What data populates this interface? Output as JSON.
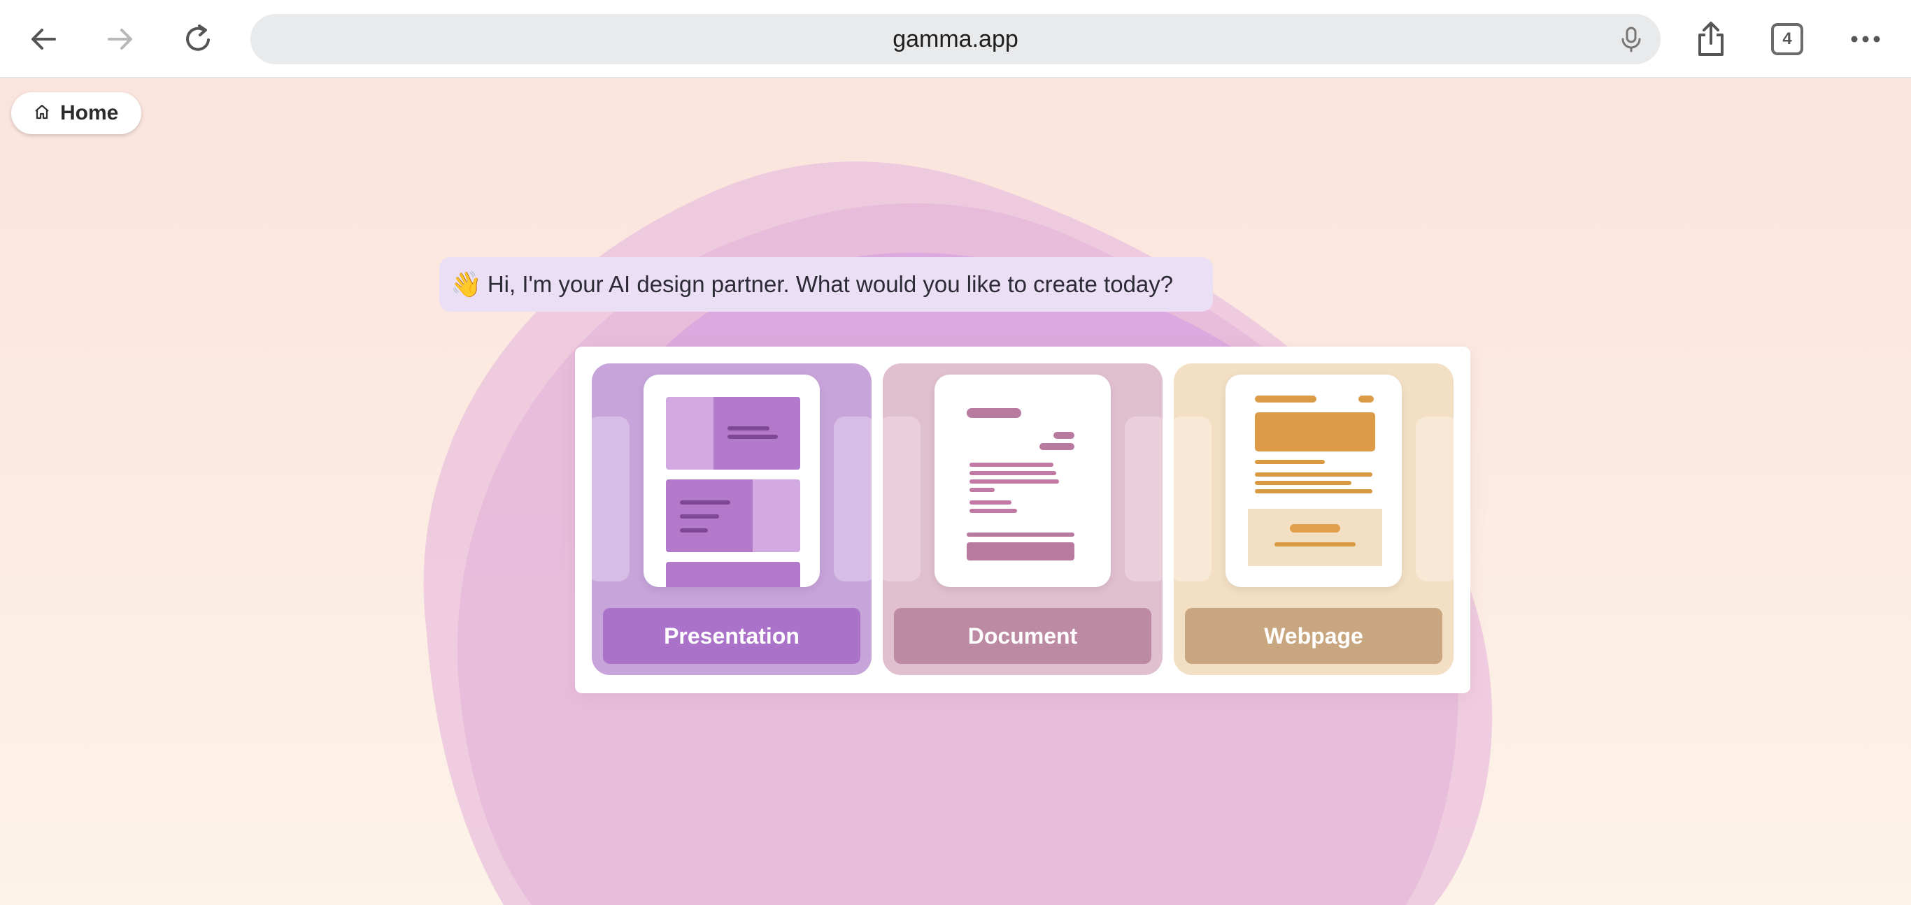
{
  "browser": {
    "url": "gamma.app",
    "tab_count": "4",
    "icons": [
      "back-arrow-icon",
      "forward-arrow-icon",
      "reload-icon",
      "microphone-icon",
      "share-icon",
      "tabs-icon",
      "more-icon"
    ]
  },
  "page": {
    "home_label": "Home",
    "greeting": {
      "emoji": "👋",
      "text": "Hi, I'm your AI design partner. What would you like to create today?"
    },
    "options": [
      {
        "label": "Presentation",
        "color": "#ab72c9"
      },
      {
        "label": "Document",
        "color": "#bc8aa3"
      },
      {
        "label": "Webpage",
        "color": "#c8a67f"
      }
    ]
  },
  "colors": {
    "background": "#fbe6de",
    "greeting_bg": "#ebdff5",
    "presentation_card": "#c7a4da",
    "document_card": "#e0bfcf",
    "webpage_card": "#f3dfc4",
    "webpage_accent": "#dc9b47"
  }
}
